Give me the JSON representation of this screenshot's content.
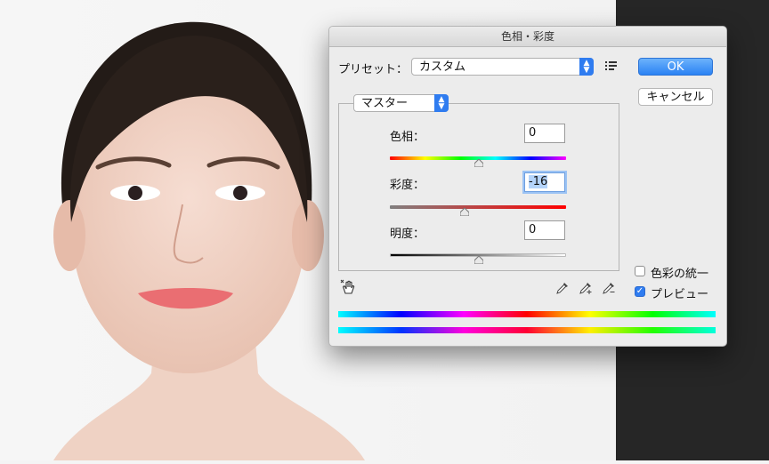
{
  "dialog": {
    "title": "色相・彩度",
    "preset_label": "プリセット：",
    "preset_value": "カスタム",
    "ok_label": "OK",
    "cancel_label": "キャンセル",
    "channel_value": "マスター",
    "colorize_label": "色彩の統一",
    "colorize_checked": false,
    "preview_label": "プレビュー",
    "preview_checked": true,
    "check_mark": "✓"
  },
  "adjustments": [
    {
      "name": "hue",
      "label": "色相：",
      "value": "0"
    },
    {
      "name": "saturation",
      "label": "彩度：",
      "value": "-16"
    },
    {
      "name": "lightness",
      "label": "明度：",
      "value": "0"
    }
  ],
  "icons": {
    "preset_menu": "list-options-icon",
    "hand_tool": "targeted-adjustment-hand-icon",
    "eyedroppers": [
      "eyedropper-icon",
      "eyedropper-add-icon",
      "eyedropper-subtract-icon"
    ]
  },
  "colors": {
    "accent": "#2f7cf0",
    "dark_panel": "#262626"
  }
}
